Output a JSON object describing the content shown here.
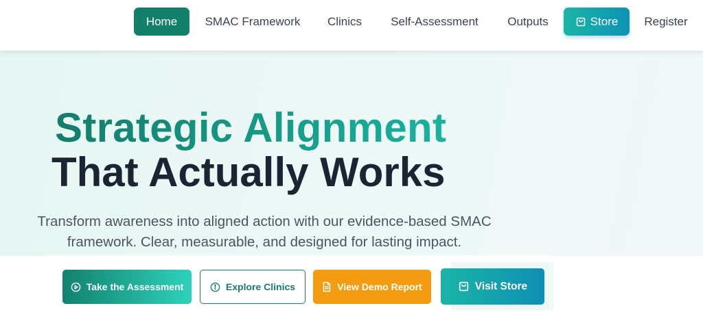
{
  "nav": {
    "items": [
      {
        "label": "Home",
        "active": true
      },
      {
        "label": "SMAC Framework"
      },
      {
        "label": "Clinics"
      },
      {
        "label": "Self-Assessment"
      },
      {
        "label": "Outputs"
      },
      {
        "label": "Store",
        "icon": "shopping-bag-icon"
      },
      {
        "label": "Register"
      }
    ]
  },
  "hero": {
    "headline_line1": "Strategic Alignment",
    "headline_line2": "That Actually Works",
    "subtitle_line1": "Transform awareness into aligned action with our evidence-based SMAC",
    "subtitle_line2": "framework. Clear, measurable, and designed for lasting impact."
  },
  "cta": {
    "assessment": {
      "label": "Take the Assessment",
      "icon": "play-circle-icon"
    },
    "clinics": {
      "label": "Explore Clinics",
      "icon": "info-circle-icon"
    },
    "demo": {
      "label": "View Demo Report",
      "icon": "document-icon"
    },
    "store": {
      "label": "Visit Store",
      "icon": "shopping-bag-icon"
    }
  },
  "colors": {
    "primary": "#13806c",
    "accent_teal": "#1ab5a6",
    "accent_blue": "#0e92b5",
    "orange": "#f39c12",
    "dark_text": "#1b2433",
    "hero_bg": "#e6f6f3"
  }
}
